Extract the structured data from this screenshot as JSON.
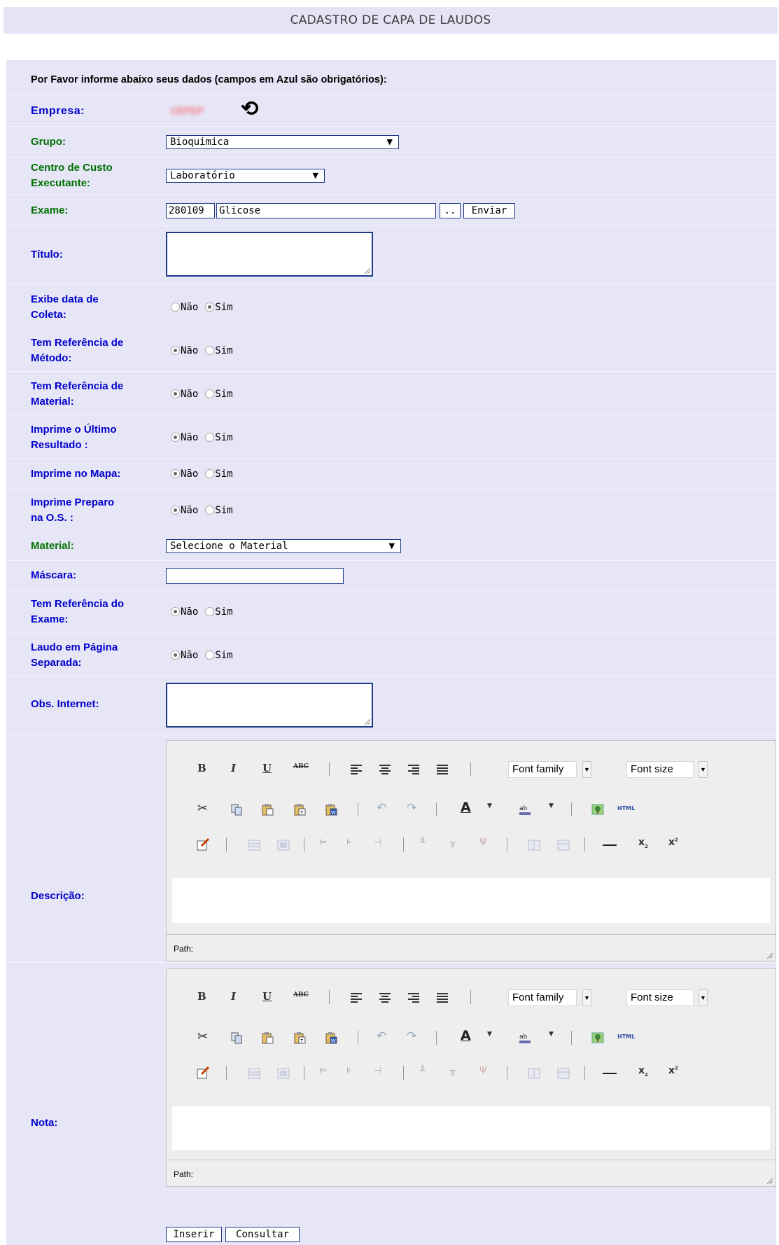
{
  "page": {
    "title": "CADASTRO DE CAPA DE LAUDOS"
  },
  "intro": "Por Favor informe abaixo seus dados (campos em Azul são obrigatórios):",
  "fields": {
    "empresa": {
      "label": "Empresa:",
      "value": "CEPEP"
    },
    "grupo": {
      "label": "Grupo:",
      "value": "Bioquimica"
    },
    "centro_custo": {
      "label_line1": "Centro de Custo",
      "label_line2": "Executante:",
      "value": "Laboratório"
    },
    "exame": {
      "label": "Exame:",
      "code": "280109",
      "name": "Glicose",
      "lookup_btn": "..",
      "send_btn": "Enviar"
    },
    "titulo": {
      "label": "Título:",
      "value": ""
    },
    "exibe_data": {
      "label_line1": "Exibe data de",
      "label_line2": "Coleta:"
    },
    "ref_metodo": {
      "label_line1": "Tem Referência de",
      "label_line2": "Método:"
    },
    "ref_material": {
      "label_line1": "Tem Referência de",
      "label_line2": "Material:"
    },
    "ultimo_resultado": {
      "label_line1": "Imprime o Último",
      "label_line2": "Resultado :"
    },
    "imprime_mapa": {
      "label": "Imprime no Mapa:"
    },
    "imprime_preparo": {
      "label_line1": "Imprime Preparo",
      "label_line2": "na O.S. :"
    },
    "material": {
      "label": "Material:",
      "value": "Selecione o Material"
    },
    "mascara": {
      "label": "Máscara:",
      "value": ""
    },
    "ref_exame": {
      "label_line1": "Tem Referência do",
      "label_line2": "Exame:"
    },
    "laudo_pagina": {
      "label_line1": "Laudo em Página",
      "label_line2": "Separada:"
    },
    "obs_internet": {
      "label": "Obs. Internet:",
      "value": ""
    },
    "descricao": {
      "label": "Descrição:"
    },
    "nota": {
      "label": "Nota:"
    }
  },
  "radio": {
    "nao": "Não",
    "sim": "Sim"
  },
  "editor": {
    "font_family": "Font family",
    "font_size": "Font size",
    "path_label": "Path:",
    "bold": "B",
    "italic": "I",
    "underline": "U",
    "strike": "ABC",
    "html": "HTML",
    "icons": [
      "bold-icon",
      "italic-icon",
      "underline-icon",
      "strikethrough-icon",
      "align-left-icon",
      "align-center-icon",
      "align-right-icon",
      "align-justify-icon",
      "cut-icon",
      "copy-icon",
      "paste-icon",
      "paste-text-icon",
      "paste-word-icon",
      "undo-icon",
      "redo-icon",
      "text-color-icon",
      "highlight-color-icon",
      "image-icon",
      "html-source-icon",
      "cleanup-icon",
      "table-icons",
      "horizontal-rule-icon",
      "subscript-icon",
      "superscript-icon"
    ]
  },
  "buttons": {
    "inserir": "Inserir",
    "consultar": "Consultar"
  },
  "colors": {
    "required_label": "#0000cc",
    "optional_label": "#007000",
    "form_bg": "#e6e6f7",
    "header_bg": "#e4e4f6",
    "input_border": "#1c3b88"
  }
}
